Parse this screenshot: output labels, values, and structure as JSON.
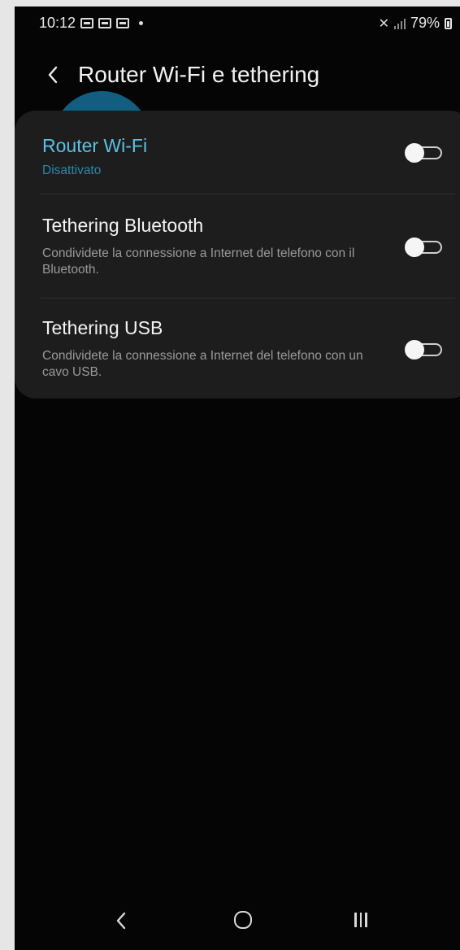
{
  "status_bar": {
    "time": "10:12",
    "battery": "79%",
    "icons": [
      "gallery-notification-icon",
      "gallery-notification-icon",
      "gallery-notification-icon",
      "more-dot-icon",
      "mute-icon",
      "signal-icon",
      "battery-icon"
    ]
  },
  "header": {
    "back_icon": "chevron-left-icon",
    "title": "Router Wi-Fi e tethering"
  },
  "settings": [
    {
      "title": "Router Wi-Fi",
      "subtitle": "Disattivato",
      "enabled": false
    },
    {
      "title": "Tethering Bluetooth",
      "subtitle": "Condividete la connessione a Internet del telefono con il Bluetooth.",
      "enabled": false
    },
    {
      "title": "Tethering USB",
      "subtitle": "Condividete la connessione a Internet del telefono con un cavo USB.",
      "enabled": false
    }
  ],
  "colors": {
    "background": "#050505",
    "card": "#1d1d1d",
    "accent_text": "#5cc0e6",
    "touch_highlight": "#146e96"
  },
  "nav_bar": {
    "icons": [
      "nav-back-icon",
      "nav-home-icon",
      "nav-recents-icon"
    ]
  }
}
